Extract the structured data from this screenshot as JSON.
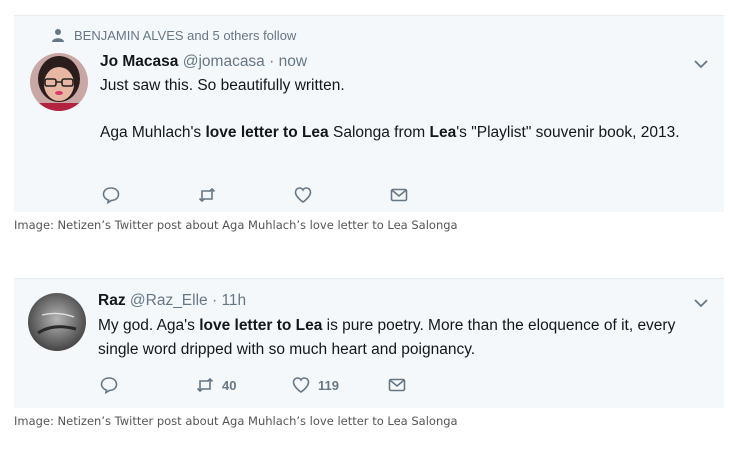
{
  "tweets": [
    {
      "social_context": "BENJAMIN ALVES and 5 others follow",
      "name": "Jo Macasa",
      "handle": "@jomacasa",
      "separator": "·",
      "time": "now",
      "line1": "Just saw this. So beautifully written.",
      "line2_parts": [
        "Aga Muhlach's ",
        "love letter to Lea",
        " Salonga from ",
        "Lea",
        "'s \"Playlist\" souvenir book, 2013."
      ],
      "counts": {
        "retweets": "",
        "likes": ""
      }
    },
    {
      "name": "Raz",
      "handle": "@Raz_Elle",
      "separator": "·",
      "time": "11h",
      "text_parts": [
        "My god. Aga's ",
        "love letter to Lea",
        " is pure poetry. More than the eloquence of it, every single word dripped with so much heart and poignancy."
      ],
      "counts": {
        "retweets": "40",
        "likes": "119"
      }
    }
  ],
  "captions": [
    "Image: Netizen’s Twitter post about Aga Muhlach’s love letter to Lea Salonga",
    "Image: Netizen’s Twitter post about Aga Muhlach’s love letter to Lea Salonga"
  ],
  "icons": {
    "reply": "reply-icon",
    "retweet": "retweet-icon",
    "like": "heart-icon",
    "dm": "envelope-icon",
    "caret": "chevron-down-icon",
    "follow_context": "person-icon"
  },
  "colors": {
    "card_bg": "#f5f8fa",
    "muted": "#657786",
    "text": "#14171a"
  }
}
